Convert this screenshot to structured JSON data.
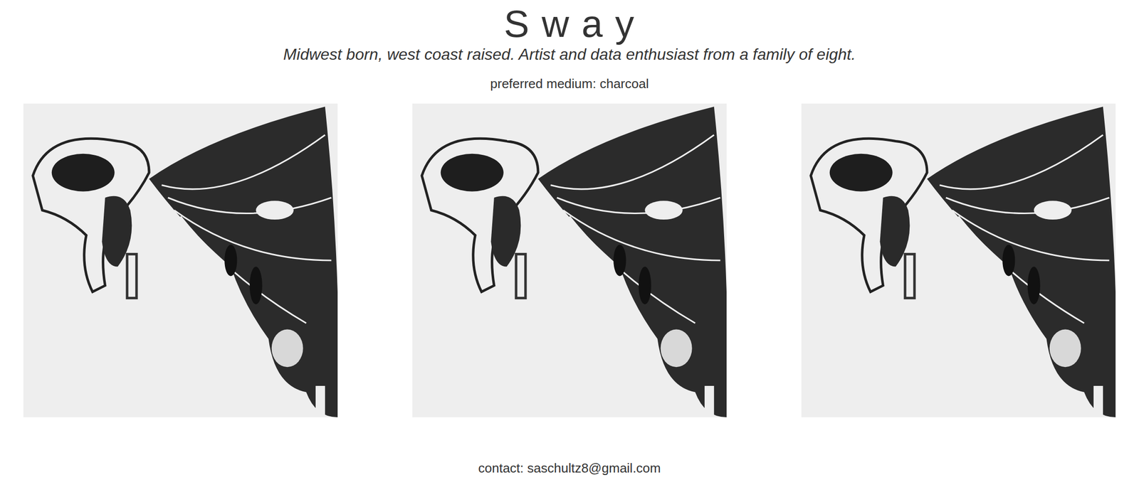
{
  "header": {
    "title": "S w a y",
    "bio": "Midwest born, west coast raised. Artist and data enthusiast from a family of eight.",
    "medium": "preferred medium: charcoal"
  },
  "gallery": {
    "images": [
      {
        "kind": "drawing"
      },
      {
        "kind": "drawing"
      },
      {
        "kind": "drawing"
      }
    ]
  },
  "footer": {
    "contact": "contact: saschultz8@gmail.com"
  }
}
